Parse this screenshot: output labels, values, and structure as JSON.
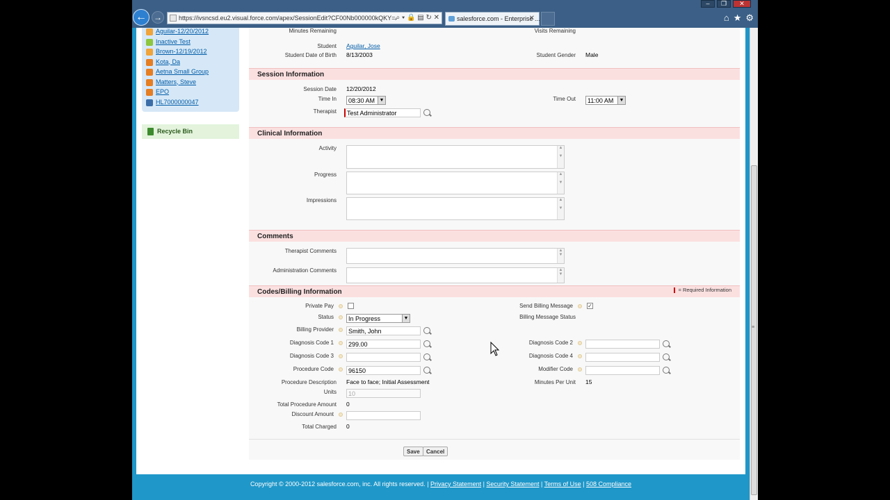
{
  "browser": {
    "url": "https://ivsncsd.eu2.visual.force.com/apex/SessionEdit?CF00Nb000000kQKY=Agui",
    "tab_title": "salesforce.com - Enterprise ..."
  },
  "sidebar": {
    "items": [
      {
        "label": "Aguilar-12/20/2012",
        "icon": "calendar-icon",
        "color": "#f0a43a"
      },
      {
        "label": "Inactive Test",
        "icon": "leaf-icon",
        "color": "#8dc63f"
      },
      {
        "label": "Brown-12/19/2012",
        "icon": "calendar-icon",
        "color": "#f0a43a"
      },
      {
        "label": "Kota, Da",
        "icon": "person-icon",
        "color": "#e67e22"
      },
      {
        "label": "Aetna Small Group",
        "icon": "group-icon",
        "color": "#e67e22"
      },
      {
        "label": "Matters, Steve",
        "icon": "person-icon",
        "color": "#e67e22"
      },
      {
        "label": "EPO",
        "icon": "group-icon",
        "color": "#e67e22"
      },
      {
        "label": "HL7000000047",
        "icon": "document-icon",
        "color": "#3b6ea8"
      }
    ],
    "recycle_bin": "Recycle Bin"
  },
  "top": {
    "minutes_remaining_label": "Minutes Remaining",
    "visits_remaining_label": "Visits Remaining",
    "student_label": "Student",
    "student_value": "Aguilar, Jose",
    "dob_label": "Student Date of Birth",
    "dob_value": "8/13/2003",
    "gender_label": "Student Gender",
    "gender_value": "Male"
  },
  "session": {
    "title": "Session Information",
    "date_label": "Session Date",
    "date_value": "12/20/2012",
    "time_in_label": "Time In",
    "time_in_value": "08:30 AM",
    "time_out_label": "Time Out",
    "time_out_value": "11:00 AM",
    "therapist_label": "Therapist",
    "therapist_value": "Test Administrator"
  },
  "clinical": {
    "title": "Clinical Information",
    "activity_label": "Activity",
    "progress_label": "Progress",
    "impressions_label": "Impressions"
  },
  "comments": {
    "title": "Comments",
    "therapist_label": "Therapist Comments",
    "admin_label": "Administration Comments"
  },
  "billing": {
    "title": "Codes/Billing Information",
    "required_info": "= Required Information",
    "private_pay_label": "Private Pay",
    "send_billing_label": "Send Billing Message",
    "status_label": "Status",
    "status_value": "In Progress",
    "billing_status_label": "Billing Message Status",
    "provider_label": "Billing Provider",
    "provider_value": "Smith, John",
    "diag1_label": "Diagnosis Code 1",
    "diag1_value": "299.00",
    "diag2_label": "Diagnosis Code 2",
    "diag3_label": "Diagnosis Code 3",
    "diag4_label": "Diagnosis Code 4",
    "proc_code_label": "Procedure Code",
    "proc_code_value": "96150",
    "modifier_label": "Modifier Code",
    "proc_desc_label": "Procedure Description",
    "proc_desc_value": "Face to face; Initial Assessment",
    "minutes_unit_label": "Minutes Per Unit",
    "minutes_unit_value": "15",
    "units_label": "Units",
    "units_value": "10",
    "total_proc_label": "Total Procedure Amount",
    "total_proc_value": "0",
    "discount_label": "Discount Amount",
    "total_charged_label": "Total Charged",
    "total_charged_value": "0"
  },
  "buttons": {
    "save": "Save",
    "cancel": "Cancel"
  },
  "footer": {
    "copyright": "Copyright © 2000-2012 salesforce.com, inc. All rights reserved. |",
    "privacy": "Privacy Statement",
    "security": "Security Statement",
    "terms": "Terms of Use",
    "compliance": "508 Compliance"
  }
}
